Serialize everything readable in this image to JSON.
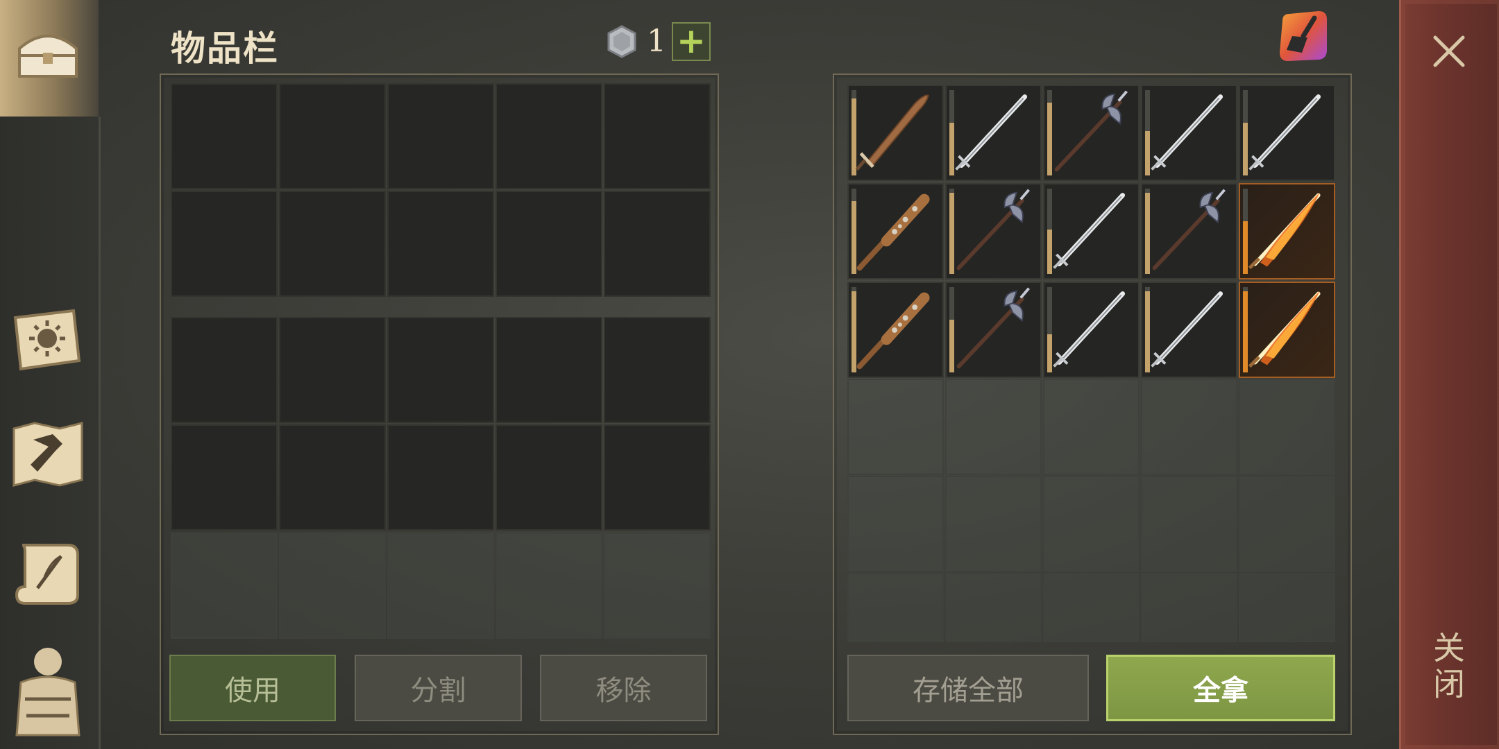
{
  "header": {
    "title": "物品栏",
    "currency_count": "1",
    "plus_label": "+"
  },
  "sidebar": {
    "items": [
      {
        "name": "chest-icon"
      },
      {
        "name": "sun-book-icon"
      },
      {
        "name": "hammer-map-icon"
      },
      {
        "name": "scroll-quill-icon"
      },
      {
        "name": "backpack-person-icon"
      }
    ]
  },
  "inventory": {
    "buttons": {
      "use": "使用",
      "split": "分割",
      "remove": "移除"
    }
  },
  "container": {
    "items": [
      {
        "icon": "sword-bronze-icon",
        "durability": 0.9,
        "rarity": "common"
      },
      {
        "icon": "longsword-icon",
        "durability": 0.62,
        "rarity": "common"
      },
      {
        "icon": "halberd-icon",
        "durability": 0.85,
        "rarity": "common"
      },
      {
        "icon": "longsword-icon",
        "durability": 0.52,
        "rarity": "common"
      },
      {
        "icon": "longsword-icon",
        "durability": 0.62,
        "rarity": "common"
      },
      {
        "icon": "spiked-club-icon",
        "durability": 0.85,
        "rarity": "common"
      },
      {
        "icon": "halberd-icon",
        "durability": 0.95,
        "rarity": "common"
      },
      {
        "icon": "longsword-icon",
        "durability": 0.52,
        "rarity": "common"
      },
      {
        "icon": "halberd-icon",
        "durability": 0.95,
        "rarity": "common"
      },
      {
        "icon": "flaming-sword-icon",
        "durability": 0.62,
        "rarity": "rare"
      },
      {
        "icon": "spiked-club-icon",
        "durability": 0.95,
        "rarity": "common"
      },
      {
        "icon": "halberd-icon",
        "durability": 0.62,
        "rarity": "common"
      },
      {
        "icon": "longsword-icon",
        "durability": 0.45,
        "rarity": "common"
      },
      {
        "icon": "longsword-icon",
        "durability": 0.95,
        "rarity": "common"
      },
      {
        "icon": "flaming-sword-icon",
        "durability": 0.95,
        "rarity": "rare"
      }
    ],
    "buttons": {
      "store_all": "存储全部",
      "take_all": "全拿"
    }
  },
  "close": {
    "label": "关闭"
  },
  "colors": {
    "accent_green": "#8fa84e",
    "close_red": "#6c342d",
    "gold_text": "#efe3c7"
  }
}
